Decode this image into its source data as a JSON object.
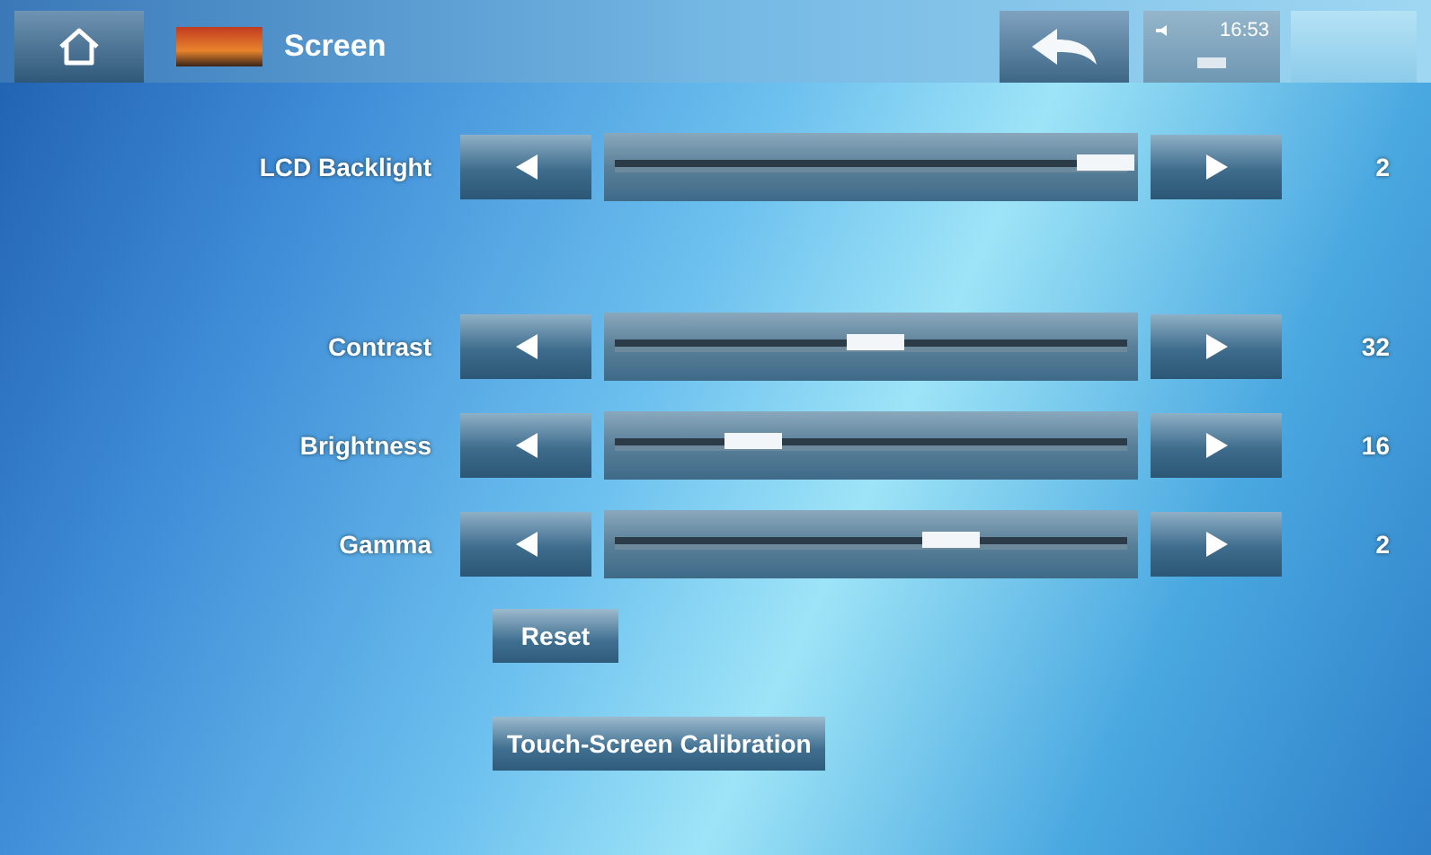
{
  "header": {
    "title": "Screen",
    "time": "16:53"
  },
  "sliders": [
    {
      "label": "LCD Backlight",
      "level": 0.94,
      "reading": "2"
    },
    {
      "label": "Contrast",
      "level": 0.51,
      "reading": "32"
    },
    {
      "label": "Brightness",
      "level": 0.28,
      "reading": "16"
    },
    {
      "label": "Gamma",
      "level": 0.65,
      "reading": "2"
    }
  ],
  "buttons": [
    "Reset",
    "Touch-Screen Calibration"
  ]
}
